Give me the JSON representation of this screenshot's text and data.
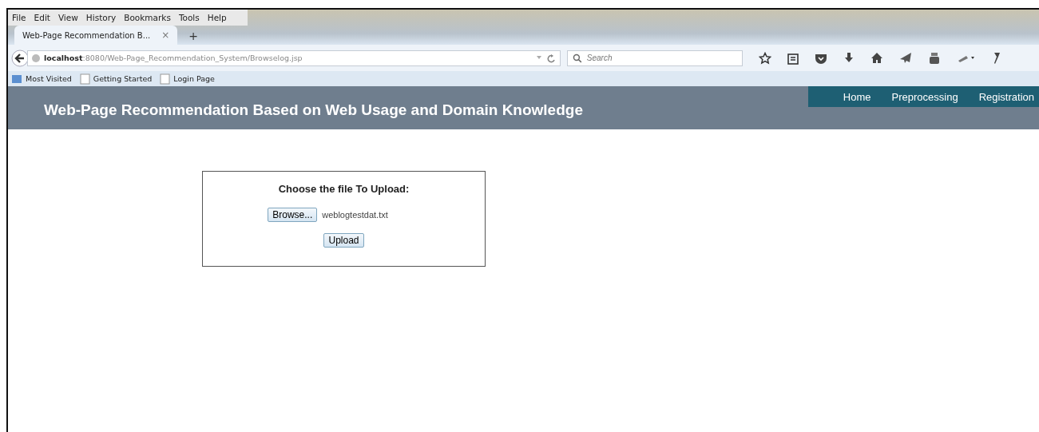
{
  "menu_bar": [
    "File",
    "Edit",
    "View",
    "History",
    "Bookmarks",
    "Tools",
    "Help"
  ],
  "tabs": [
    {
      "label": "Web-Page Recommendation B...",
      "selected": true,
      "close": "×"
    }
  ],
  "new_tab": "+",
  "address_bar": {
    "host": "localhost",
    "path": ":8080/Web-Page_Recommendation_System/Browselog.jsp"
  },
  "search": {
    "placeholder": "Search"
  },
  "bookmarks": [
    {
      "label": "Most Visited",
      "kind": "folder"
    },
    {
      "label": "Getting Started",
      "kind": "page"
    },
    {
      "label": "Login Page",
      "kind": "page"
    }
  ],
  "header": {
    "title": "Web-Page Recommendation Based on Web Usage and Domain Knowledge",
    "nav": [
      "Home",
      "Preprocessing",
      "Registration"
    ]
  },
  "upload_form": {
    "heading": "Choose the file To Upload:",
    "browse_button": "Browse...",
    "file_name": "weblogtestdat.txt",
    "upload_button": "Upload"
  }
}
